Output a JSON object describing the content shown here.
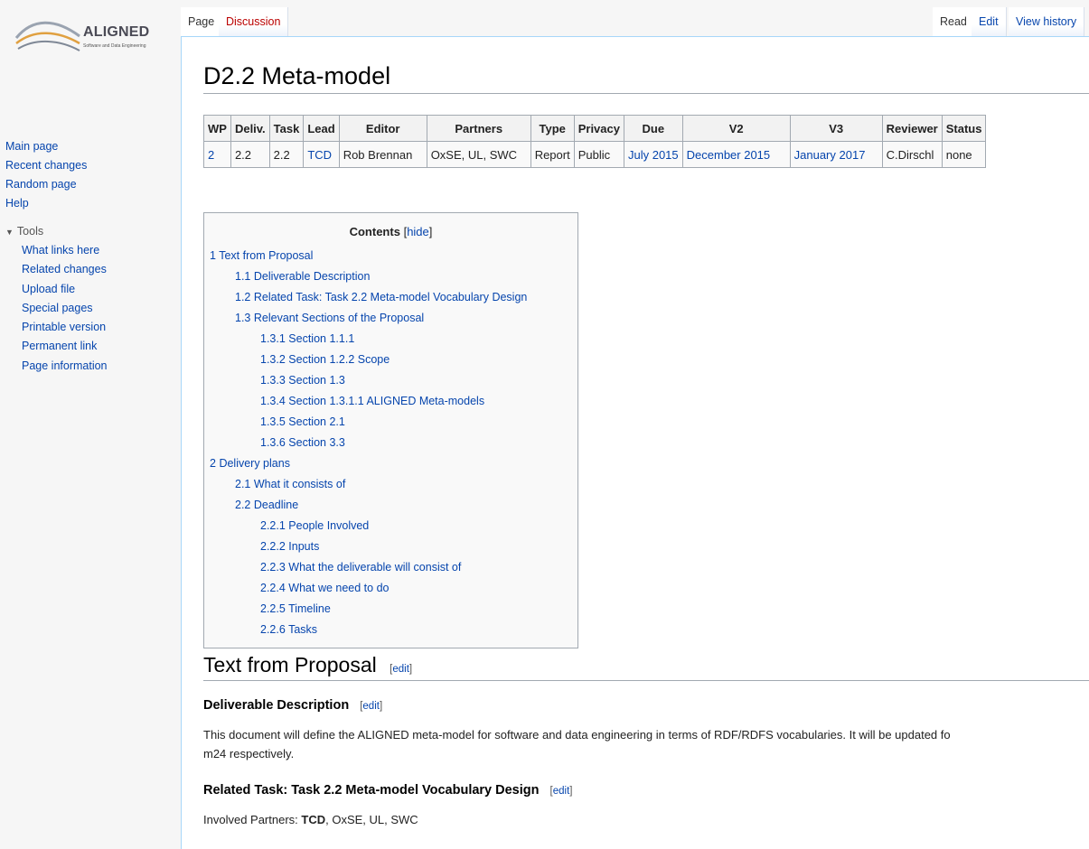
{
  "logo": {
    "brand": "ALIGNED",
    "tagline": "Software and Data Engineering"
  },
  "sidebar": {
    "main": [
      "Main page",
      "Recent changes",
      "Random page",
      "Help"
    ],
    "tools_label": "Tools",
    "tools": [
      "What links here",
      "Related changes",
      "Upload file",
      "Special pages",
      "Printable version",
      "Permanent link",
      "Page information"
    ]
  },
  "tabs": {
    "page": "Page",
    "discussion": "Discussion",
    "read": "Read",
    "edit": "Edit",
    "history": "View history"
  },
  "page_title": "D2.2 Meta-model",
  "info_table": {
    "headers": [
      "WP",
      "Deliv.",
      "Task",
      "Lead",
      "Editor",
      "Partners",
      "Type",
      "Privacy",
      "Due",
      "V2",
      "V3",
      "Reviewer",
      "Status"
    ],
    "row": [
      "2",
      "2.2",
      "2.2",
      "TCD",
      "Rob Brennan",
      "OxSE, UL, SWC",
      "Report",
      "Public",
      "July 2015",
      "December 2015",
      "January 2017",
      "C.Dirschl",
      "none"
    ]
  },
  "toc": {
    "title": "Contents",
    "hide": "hide",
    "items": [
      {
        "num": "1",
        "text": "Text from Proposal"
      },
      {
        "num": "1.1",
        "text": "Deliverable Description"
      },
      {
        "num": "1.2",
        "text": "Related Task: Task 2.2 Meta-model Vocabulary Design"
      },
      {
        "num": "1.3",
        "text": "Relevant Sections of the Proposal"
      },
      {
        "num": "1.3.1",
        "text": "Section 1.1.1"
      },
      {
        "num": "1.3.2",
        "text": "Section 1.2.2 Scope"
      },
      {
        "num": "1.3.3",
        "text": "Section 1.3"
      },
      {
        "num": "1.3.4",
        "text": "Section 1.3.1.1 ALIGNED Meta-models"
      },
      {
        "num": "1.3.5",
        "text": "Section 2.1"
      },
      {
        "num": "1.3.6",
        "text": "Section 3.3"
      },
      {
        "num": "2",
        "text": "Delivery plans"
      },
      {
        "num": "2.1",
        "text": "What it consists of"
      },
      {
        "num": "2.2",
        "text": "Deadline"
      },
      {
        "num": "2.2.1",
        "text": "People Involved"
      },
      {
        "num": "2.2.2",
        "text": "Inputs"
      },
      {
        "num": "2.2.3",
        "text": "What the deliverable will consist of"
      },
      {
        "num": "2.2.4",
        "text": "What we need to do"
      },
      {
        "num": "2.2.5",
        "text": "Timeline"
      },
      {
        "num": "2.2.6",
        "text": "Tasks"
      }
    ]
  },
  "sections": {
    "text_from_proposal": "Text from Proposal",
    "deliverable_description": "Deliverable Description",
    "deliverable_text_1": "This document will define the ALIGNED meta-model for software and data engineering in terms of RDF/RDFS vocabularies. It will be updated fo",
    "deliverable_text_2": "m24 respectively.",
    "related_task": "Related Task: Task 2.2 Meta-model Vocabulary Design",
    "involved_label": "Involved Partners: ",
    "involved_lead": "TCD",
    "involved_rest": ", OxSE, UL, SWC",
    "edit": "edit"
  }
}
